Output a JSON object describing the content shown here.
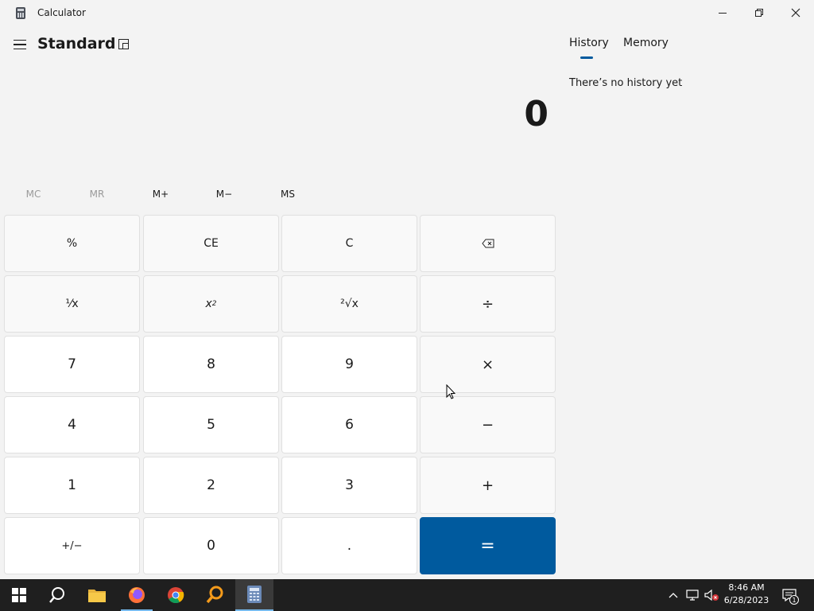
{
  "window": {
    "title": "Calculator",
    "mode": "Standard"
  },
  "display": {
    "value": "0"
  },
  "memory": {
    "buttons": [
      {
        "label": "MC",
        "enabled": false
      },
      {
        "label": "MR",
        "enabled": false
      },
      {
        "label": "M+",
        "enabled": true
      },
      {
        "label": "M−",
        "enabled": true
      },
      {
        "label": "MS",
        "enabled": true
      }
    ]
  },
  "keypad": {
    "percent": "%",
    "clear_entry": "CE",
    "clear": "C",
    "reciprocal": "⅟x",
    "square_base": "x",
    "square_exp": "2",
    "sqrt": "²√x",
    "divide": "÷",
    "seven": "7",
    "eight": "8",
    "nine": "9",
    "multiply": "×",
    "four": "4",
    "five": "5",
    "six": "6",
    "minus": "−",
    "one": "1",
    "two": "2",
    "three": "3",
    "plus": "+",
    "negate": "+/−",
    "zero": "0",
    "decimal": ".",
    "equals": "="
  },
  "side_panel": {
    "tabs": [
      "History",
      "Memory"
    ],
    "active_tab": "History",
    "empty_message": "There’s no history yet"
  },
  "taskbar": {
    "time": "8:46 AM",
    "date": "6/28/2023",
    "notification_count": "1",
    "apps": [
      "start-icon",
      "search-icon",
      "file-explorer-icon",
      "firefox-icon",
      "chrome-icon",
      "search-tool-icon",
      "calculator-icon"
    ]
  },
  "colors": {
    "accent": "#005a9e",
    "window_bg": "#f3f3f3",
    "taskbar_bg": "#1f1f1f"
  }
}
